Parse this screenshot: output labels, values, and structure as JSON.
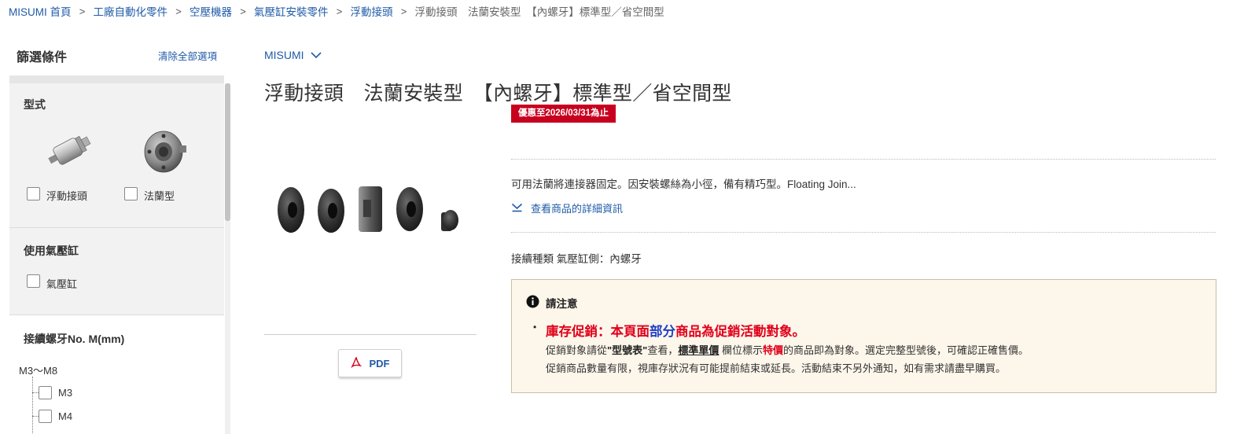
{
  "breadcrumb": {
    "items": [
      "MISUMI 首頁",
      "工廠自動化零件",
      "空壓機器",
      "氣壓缸安裝零件",
      "浮動接頭"
    ],
    "current": "浮動接頭　法蘭安裝型　【內螺牙】標準型／省空間型",
    "separator": "›"
  },
  "sidebar": {
    "title": "篩選條件",
    "clear_all": "清除全部選項",
    "sections": {
      "type": {
        "title": "型式",
        "options": [
          "浮動接頭",
          "法蘭型"
        ]
      },
      "cylinder": {
        "title": "使用氣壓缸",
        "options": [
          "氣壓缸"
        ]
      },
      "thread": {
        "title": "接續螺牙No. M(mm)",
        "group": "M3～M8",
        "options": [
          "M3",
          "M4"
        ]
      }
    }
  },
  "main": {
    "brand": "MISUMI",
    "title": "浮動接頭　法蘭安裝型　【內螺牙】標準型／省空間型",
    "promo_badge": "優惠至2026/03/31為止",
    "description": "可用法蘭將連接器固定。因安裝螺絲為小徑，備有精巧型。Floating Join...",
    "detail_link": "查看商品的詳細資訊",
    "spec": "接續種類 氣壓缸側：內螺牙",
    "pdf_label": "PDF",
    "notice": {
      "heading": "請注意",
      "promo_part1": "庫存促銷：本頁面",
      "promo_part2": "部分",
      "promo_part3": "商品為促銷活動對象。",
      "line1_a": "促銷對象請從",
      "line1_b": "\"型號表\"",
      "line1_c": "查看，",
      "line1_d": "標準單價",
      "line1_e": " 欄位標示",
      "line1_f": "特價",
      "line1_g": "的商品即為對象。選定完整型號後，可確認正確售價。",
      "line2": "促銷商品數量有限，視庫存狀況有可能提前結束或延長。活動結束不另外通知，如有需求請盡早購買。"
    }
  },
  "colors": {
    "link": "#1f5ba8",
    "promo_red": "#c8001f",
    "notice_bg": "#fdf6ea",
    "emphasis_blue": "#1f3fc8"
  }
}
